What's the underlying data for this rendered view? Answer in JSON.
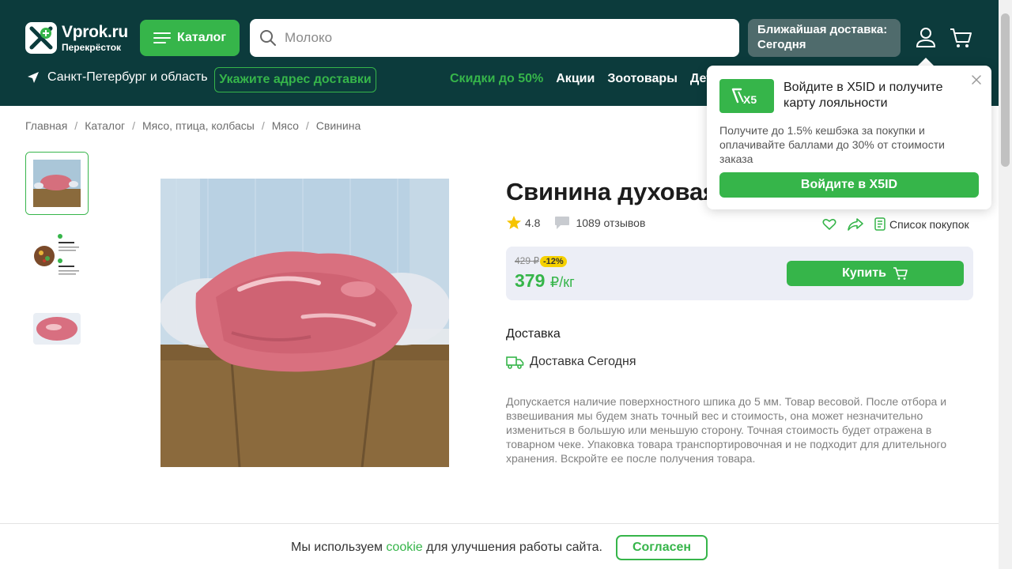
{
  "header": {
    "logo_title": "Vprok.ru",
    "logo_subtitle": "Перекрёсток",
    "catalog_label": "Каталог",
    "search_placeholder": "Молоко",
    "delivery_label": "Ближайшая доставка: Сегодня",
    "region": "Санкт-Петербург и область",
    "address_button": "Укажите адрес доставки",
    "nav": [
      {
        "label": "Скидки до 50%",
        "color": "#36b54a"
      },
      {
        "label": "Акции"
      },
      {
        "label": "Зоотовары"
      },
      {
        "label": "Детс"
      }
    ]
  },
  "breadcrumb": [
    "Главная",
    "Каталог",
    "Мясо, птица, колбасы",
    "Мясо",
    "Свинина"
  ],
  "product": {
    "title": "Свинина духовая",
    "rating": "4.8",
    "reviews": "1089 отзывов",
    "shopping_list": "Список покупок",
    "old_price": "429 ₽",
    "discount": "-12%",
    "price": "379",
    "price_unit": "₽/кг",
    "buy_label": "Купить",
    "delivery_heading": "Доставка",
    "delivery_text": "Доставка Сегодня",
    "description": "Допускается наличие поверхностного шпика до 5 мм. Товар весовой. После отбора и взвешивания мы будем знать точный вес и стоимость, она может незначительно измениться в большую или меньшую сторону. Точная стоимость будет отражена в товарном чеке. Упаковка товара транспортировочная и не подходит для длительного хранения. Вскройте ее после получения товара."
  },
  "popup": {
    "badge": "X5",
    "title": "Войдите в X5ID и получите карту лояльности",
    "text": "Получите до 1.5% кешбэка за покупки и оплачивайте баллами до 30% от стоимости заказа",
    "button": "Войдите в X5ID"
  },
  "cookie": {
    "text_before": "Мы используем ",
    "link": "cookie",
    "text_after": " для улучшения работы сайта.",
    "button": "Согласен"
  },
  "colors": {
    "header_bg": "#0c3b3c",
    "accent": "#36b54a",
    "discount_badge": "#f6d100"
  }
}
